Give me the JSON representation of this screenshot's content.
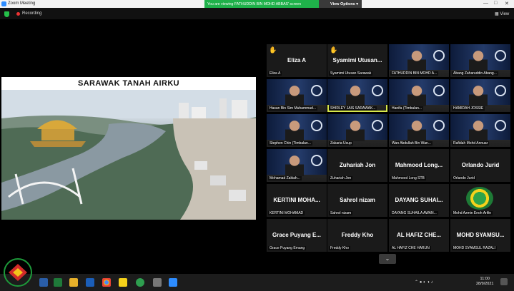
{
  "window": {
    "title": "Zoom Meeting",
    "controls": [
      "—",
      "□",
      "✕"
    ]
  },
  "share_banner": {
    "message": "You are viewing FATHUDDIN BIN MOHD ABBAS' screen",
    "options_label": "View Options ▾"
  },
  "toolbar": {
    "recording_label": "Recording",
    "view_label": "View"
  },
  "shared_screen": {
    "title": "SARAWAK TANAH AIRKU"
  },
  "participants": [
    {
      "id": "eliza",
      "big_name": "Eliza A",
      "caption": "Eliza A",
      "raised_hand": true,
      "video": false
    },
    {
      "id": "syamimi",
      "big_name": "Syamimi  Utusan...",
      "caption": "Syamimi Utusan Sarawak",
      "raised_hand": true,
      "video": false
    },
    {
      "id": "fathuddin",
      "big_name": "",
      "caption": "FATHUDDIN BIN MOHD A...",
      "raised_hand": false,
      "video": true
    },
    {
      "id": "abang",
      "big_name": "",
      "caption": "Abang Zaharuddin Abang...",
      "raised_hand": false,
      "video": true
    },
    {
      "id": "hasan",
      "big_name": "",
      "caption": "Hasan Bin Sim Muhammad...",
      "raised_hand": false,
      "video": true
    },
    {
      "id": "shirley",
      "big_name": "",
      "caption": "SHIRLEY JAIS SARAWAK...",
      "raised_hand": false,
      "video": true,
      "active": true
    },
    {
      "id": "hanifa",
      "big_name": "",
      "caption": "Hanifa (Timbalan...",
      "raised_hand": false,
      "video": true
    },
    {
      "id": "hamidah",
      "big_name": "",
      "caption": "HAMIDAH JOSSIE",
      "raised_hand": false,
      "video": true
    },
    {
      "id": "stephen",
      "big_name": "",
      "caption": "Stephen Chin (Timbalan...",
      "raised_hand": false,
      "video": true
    },
    {
      "id": "zakaria",
      "big_name": "",
      "caption": "Zakaria Usup",
      "raised_hand": false,
      "video": true
    },
    {
      "id": "wan",
      "big_name": "",
      "caption": "Wan Abdullah Bin Wan...",
      "raised_hand": false,
      "video": true
    },
    {
      "id": "rafidah",
      "big_name": "",
      "caption": "Rafidah Mohd Annuar",
      "raised_hand": false,
      "video": true
    },
    {
      "id": "mohamad",
      "big_name": "",
      "caption": "Mohamad Zakiah...",
      "raised_hand": false,
      "video": true
    },
    {
      "id": "zuhariah",
      "big_name": "Zuhariah Jon",
      "caption": "Zuhariah Jon",
      "raised_hand": false,
      "video": false
    },
    {
      "id": "mahmood",
      "big_name": "Mahmood  Long...",
      "caption": "Mahmood Long STB",
      "raised_hand": false,
      "video": false
    },
    {
      "id": "orlando",
      "big_name": "Orlando Jurid",
      "caption": "Orlando Jurid",
      "raised_hand": false,
      "video": false
    },
    {
      "id": "kertini",
      "big_name": "KERTINI  MOHA...",
      "caption": "KERTINI MOHAMAD",
      "raised_hand": false,
      "video": false
    },
    {
      "id": "sahrol",
      "big_name": "Sahrol nizam",
      "caption": "Sahrol nizam",
      "raised_hand": false,
      "video": false
    },
    {
      "id": "dayang",
      "big_name": "DAYANG  SUHAI...",
      "caption": "DAYANG SUHAILA AWAN...",
      "raised_hand": false,
      "video": false
    },
    {
      "id": "mohdazmin",
      "big_name": "",
      "caption": "Mohd Azmin Enoh Arifin",
      "raised_hand": false,
      "video": false,
      "logo": true
    },
    {
      "id": "grace",
      "big_name": "Grace Puyang E...",
      "caption": "Grace Puyang Emang",
      "raised_hand": false,
      "video": false
    },
    {
      "id": "freddy",
      "big_name": "Freddy Kho",
      "caption": "Freddy Kho",
      "raised_hand": false,
      "video": false
    },
    {
      "id": "alhafiz",
      "big_name": "AL HAFIZ  CHE...",
      "caption": "AL HAFIZ CHE HARUN",
      "raised_hand": false,
      "video": false
    },
    {
      "id": "mohdsyam",
      "big_name": "MOHD  SYAMSU...",
      "caption": "MOHD SYAMSUL RAZALI",
      "raised_hand": false,
      "video": false
    }
  ],
  "taskbar": {
    "time": "11:00",
    "date": "28/9/2021"
  }
}
